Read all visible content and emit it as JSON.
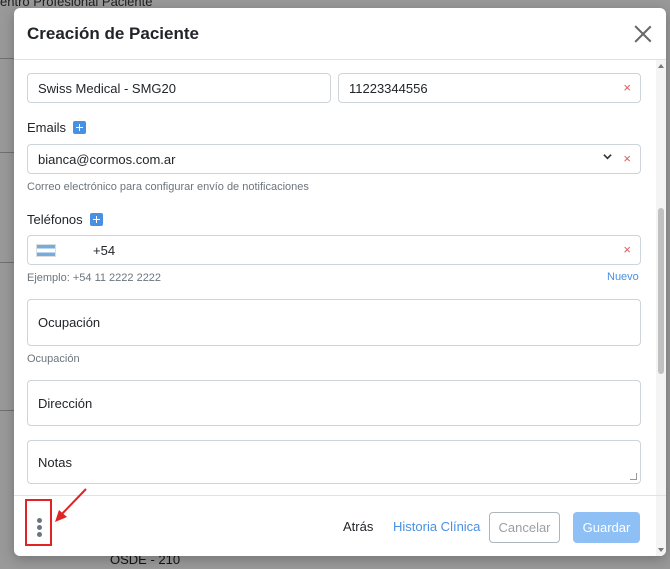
{
  "background": {
    "top_text": "entro  Profesional  Paciente",
    "bottom_text": "OSDE - 210"
  },
  "modal": {
    "title": "Creación de Paciente",
    "insurance": {
      "value": "Swiss Medical - SMG20"
    },
    "member_number": {
      "value": "11223344556"
    },
    "emails": {
      "label": "Emails",
      "value": "bianca@cormos.com.ar",
      "help": "Correo electrónico para configurar envío de notificaciones"
    },
    "phones": {
      "label": "Teléfonos",
      "value": "+54",
      "help": "Ejemplo: +54 11 2222 2222",
      "new_link": "Nuevo"
    },
    "occupation": {
      "placeholder": "Ocupación",
      "help": "Ocupación"
    },
    "address": {
      "placeholder": "Dirección"
    },
    "notes": {
      "placeholder": "Notas"
    },
    "clear_glyph": "×",
    "footer": {
      "back": "Atrás",
      "clinical_history": "Historia Clínica",
      "cancel": "Cancelar",
      "save": "Guardar"
    }
  },
  "colors": {
    "accent": "#4a90e2",
    "primary_disabled": "#8ec0f5",
    "danger": "#e05a5a",
    "annotation": "#e02424"
  },
  "icons": {
    "close": "close-icon",
    "add": "plus-icon",
    "dropdown": "chevron-down-icon",
    "flag": "argentina-flag-icon",
    "more": "kebab-menu-icon"
  }
}
